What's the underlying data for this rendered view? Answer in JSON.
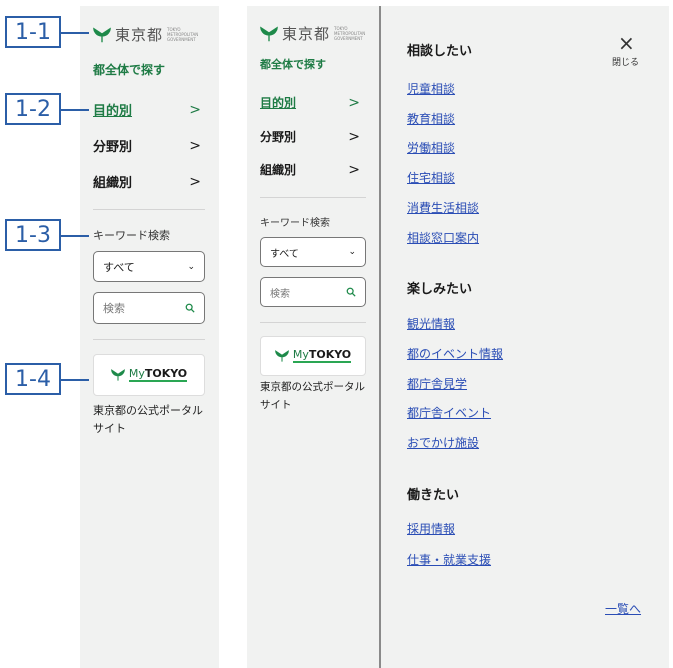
{
  "brand": {
    "logo_text": "東京都",
    "logo_sub": "TOKYO METROPOLITAN GOVERNMENT",
    "accent_color": "#1e7b45",
    "link_color": "#2a4db5",
    "callout_color": "#2b5ea7"
  },
  "sidebar": {
    "search_all": "都全体で探す",
    "items": [
      {
        "label": "目的別",
        "chevron": ">"
      },
      {
        "label": "分野別",
        "chevron": ">"
      },
      {
        "label": "組織別",
        "chevron": ">"
      }
    ],
    "keyword_label": "キーワード検索",
    "select_value": "すべて",
    "select_chevron": "⌄",
    "search_placeholder": "検索",
    "mytokyo_label_my": "My",
    "mytokyo_label_tokyo": "TOKYO",
    "portal_text": "東京都の公式ポータルサイト"
  },
  "callouts": [
    "1-1",
    "1-2",
    "1-3",
    "1-4"
  ],
  "megamenu": {
    "close_label": "閉じる",
    "close_icon": "×",
    "sections": [
      {
        "title": "相談したい",
        "links": [
          "児童相談",
          "教育相談",
          "労働相談",
          "住宅相談",
          "消費生活相談",
          "相談窓口案内"
        ]
      },
      {
        "title": "楽しみたい",
        "links": [
          "観光情報",
          "都のイベント情報",
          "都庁舎見学",
          "都庁舎イベント",
          "おでかけ施設"
        ]
      },
      {
        "title": "働きたい",
        "links": [
          "採用情報",
          "仕事・就業支援"
        ]
      }
    ],
    "more_link": "一覧へ"
  }
}
